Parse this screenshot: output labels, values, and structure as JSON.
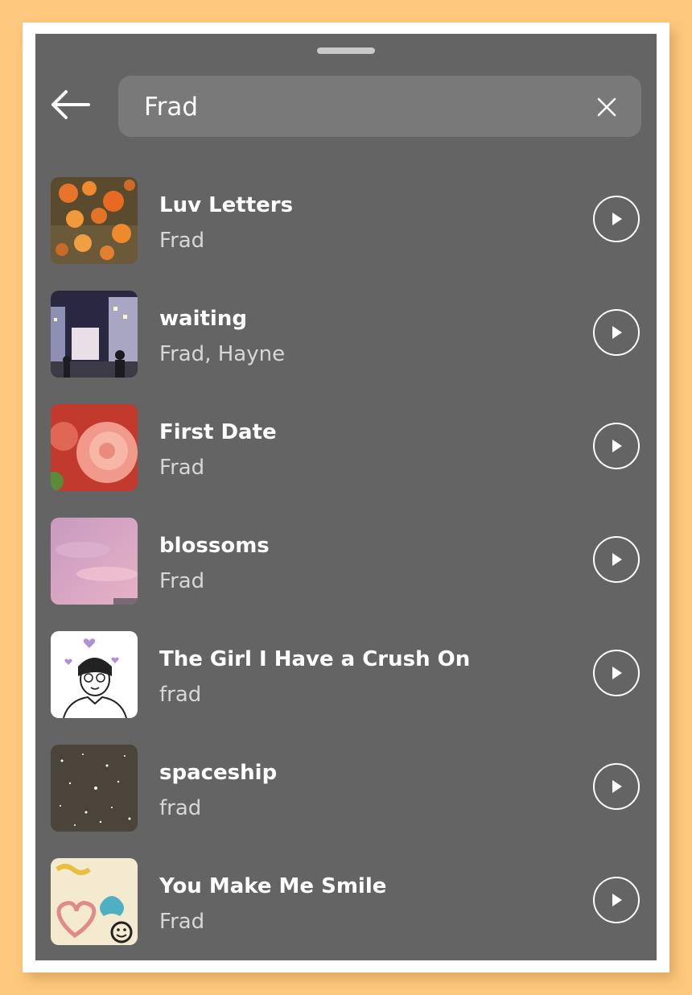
{
  "search": {
    "query": "Frad"
  },
  "icons": {
    "back": "arrow-left-icon",
    "clear": "close-icon",
    "play": "play-icon"
  },
  "colors": {
    "page_background": "#fdc97e",
    "sheet_background": "#646464",
    "search_background": "#797979",
    "primary_text": "#ffffff",
    "secondary_text": "#d7d7d7"
  },
  "results": [
    {
      "title": "Luv Letters",
      "artist": "Frad"
    },
    {
      "title": "waiting",
      "artist": "Frad, Hayne"
    },
    {
      "title": "First Date",
      "artist": "Frad"
    },
    {
      "title": "blossoms",
      "artist": "Frad"
    },
    {
      "title": "The Girl I Have a Crush On",
      "artist": "frad"
    },
    {
      "title": "spaceship",
      "artist": "frad"
    },
    {
      "title": "You Make Me Smile",
      "artist": "Frad"
    }
  ]
}
